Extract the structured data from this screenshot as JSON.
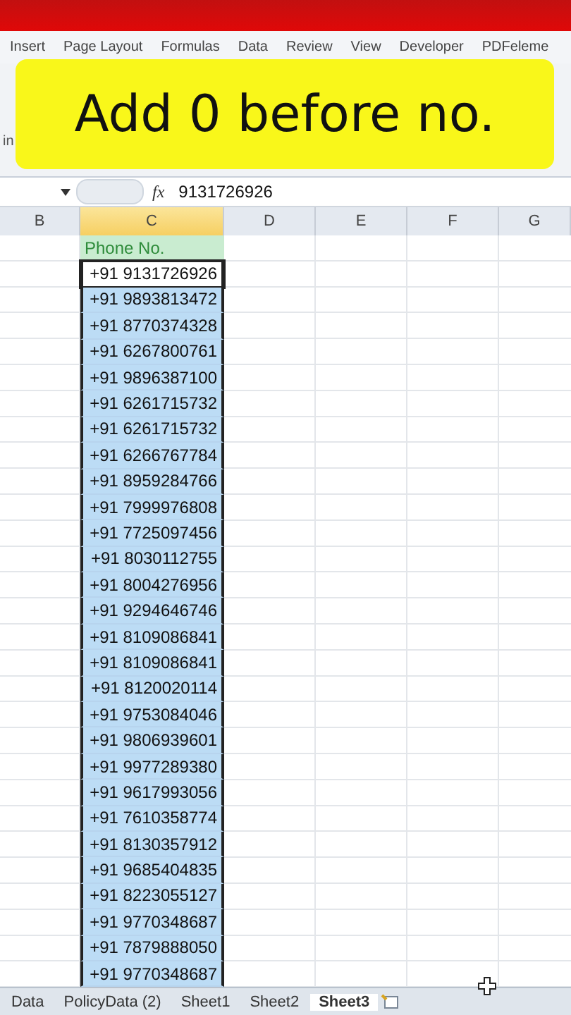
{
  "menu_tabs": [
    "Insert",
    "Page Layout",
    "Formulas",
    "Data",
    "Review",
    "View",
    "Developer",
    "PDFeleme"
  ],
  "ribbon_fragment": "in",
  "banner": "Add 0 before no.",
  "formula_bar": {
    "function_label": "fx",
    "value": "9131726926"
  },
  "columns": [
    {
      "label": "B",
      "selected": false
    },
    {
      "label": "C",
      "selected": true
    },
    {
      "label": "D",
      "selected": false
    },
    {
      "label": "E",
      "selected": false
    },
    {
      "label": "F",
      "selected": false
    },
    {
      "label": "G",
      "selected": false
    }
  ],
  "header_cell": "Phone No.",
  "phones": [
    {
      "value": "+91 9131726926",
      "selected": true,
      "active": true
    },
    {
      "value": "+91 9893813472",
      "selected": true,
      "active": false
    },
    {
      "value": "+91 8770374328",
      "selected": true,
      "active": false
    },
    {
      "value": "+91 6267800761",
      "selected": true,
      "active": false
    },
    {
      "value": "+91 9896387100",
      "selected": true,
      "active": false
    },
    {
      "value": "+91 6261715732",
      "selected": true,
      "active": false
    },
    {
      "value": "+91 6261715732",
      "selected": true,
      "active": false
    },
    {
      "value": "+91 6266767784",
      "selected": true,
      "active": false
    },
    {
      "value": "+91 8959284766",
      "selected": true,
      "active": false
    },
    {
      "value": "+91 7999976808",
      "selected": true,
      "active": false
    },
    {
      "value": "+91 7725097456",
      "selected": true,
      "active": false
    },
    {
      "value": "+91 8030112755",
      "selected": true,
      "active": false
    },
    {
      "value": "+91 8004276956",
      "selected": true,
      "active": false
    },
    {
      "value": "+91 9294646746",
      "selected": true,
      "active": false
    },
    {
      "value": "+91 8109086841",
      "selected": true,
      "active": false
    },
    {
      "value": "+91 8109086841",
      "selected": true,
      "active": false
    },
    {
      "value": "+91 8120020114",
      "selected": true,
      "active": false
    },
    {
      "value": "+91 9753084046",
      "selected": true,
      "active": false
    },
    {
      "value": "+91 9806939601",
      "selected": true,
      "active": false
    },
    {
      "value": "+91 9977289380",
      "selected": true,
      "active": false
    },
    {
      "value": "+91 9617993056",
      "selected": true,
      "active": false
    },
    {
      "value": "+91 7610358774",
      "selected": true,
      "active": false
    },
    {
      "value": "+91 8130357912",
      "selected": true,
      "active": false
    },
    {
      "value": "+91 9685404835",
      "selected": true,
      "active": false
    },
    {
      "value": "+91 8223055127",
      "selected": true,
      "active": false
    },
    {
      "value": "+91 9770348687",
      "selected": true,
      "active": false
    },
    {
      "value": "+91 7879888050",
      "selected": true,
      "active": false
    },
    {
      "value": "+91 9770348687",
      "selected": true,
      "active": false
    }
  ],
  "sheet_tabs": [
    {
      "label": "Data",
      "selected": false
    },
    {
      "label": "PolicyData (2)",
      "selected": false
    },
    {
      "label": "Sheet1",
      "selected": false
    },
    {
      "label": "Sheet2",
      "selected": false
    },
    {
      "label": "Sheet3",
      "selected": true
    }
  ]
}
